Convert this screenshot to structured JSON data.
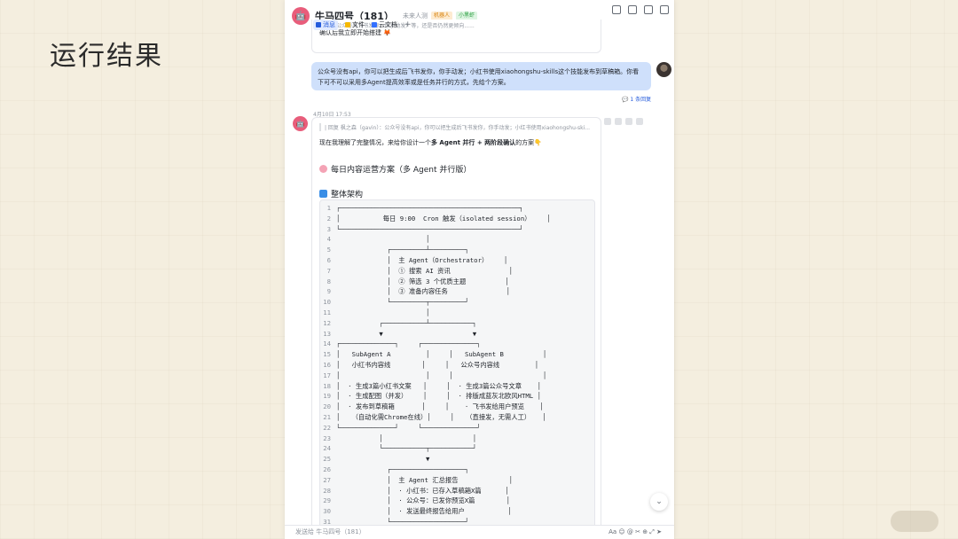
{
  "slide": {
    "title": "运行结果"
  },
  "chat": {
    "group_name": "牛马四号（181）",
    "group_meta": "未来人测",
    "tags": [
      "机器人",
      "小黑虾"
    ],
    "tabs": [
      {
        "label": "消息",
        "color": "#245bdb",
        "active": true
      },
      {
        "label": "文件",
        "color": "#f5b800",
        "active": false
      },
      {
        "label": "云文档",
        "color": "#3370ff",
        "active": false
      }
    ],
    "tab_add": "+",
    "prev_message": {
      "faded": "...... 从公众号先飞书发你，你手动发）等，还是否仍然更倾向......",
      "text": "确认后我立即开始搭建 🦊"
    },
    "user_message": "公众号没有api，你可以把生成后飞书发你，你手动发；小红书使用xiaohongshu-skills这个技能发布到草稿箱。你看下可不可以采用多Agent提高效率或是任务并行的方式，先给个方案。",
    "reply_count": "1 条回复",
    "timestamp": "4月10日 17:53",
    "bot_message": {
      "quote": "| 回复 枫之森（gavin）：公众号没有api，你可以把生成后飞书发你，你手动发；小红书使用xiaohongshu-ski...",
      "intro_before": "现在我理解了完整情况，来给你设计一个",
      "intro_bold": "多 Agent 并行 + 两阶段确认",
      "intro_after": "的方案👇",
      "plan_title": "每日内容运营方案（多 Agent 并行版）",
      "section_title": "整体架构",
      "code_lines": [
        {
          "n": "1",
          "t": "┌──────────────────────────────────────────────┐"
        },
        {
          "n": "2",
          "t": "│           每日 9:00  Cron 触发（isolated session）    │"
        },
        {
          "n": "3",
          "t": "└──────────────────────────────────────────────┘"
        },
        {
          "n": "4",
          "t": "                       │"
        },
        {
          "n": "5",
          "t": "             ┌─────────┴─────────┐"
        },
        {
          "n": "6",
          "t": "             │  主 Agent（Orchestrator）    │"
        },
        {
          "n": "7",
          "t": "             │  ① 搜索 AI 资讯               │"
        },
        {
          "n": "8",
          "t": "             │  ② 筛选 3 个优质主题          │"
        },
        {
          "n": "9",
          "t": "             │  ③ 准备内容任务               │"
        },
        {
          "n": "10",
          "t": "             └─────────┬─────────┘"
        },
        {
          "n": "11",
          "t": "                       │"
        },
        {
          "n": "12",
          "t": "           ┌───────────┴───────────┐"
        },
        {
          "n": "13",
          "t": "           ▼                       ▼"
        },
        {
          "n": "14",
          "t": "┌──────────────┐     ┌──────────────┐"
        },
        {
          "n": "15",
          "t": "│   SubAgent A         │     │   SubAgent B          │"
        },
        {
          "n": "16",
          "t": "│   小红书内容线        │     │   公众号内容线         │"
        },
        {
          "n": "17",
          "t": "│                      │     │                       │"
        },
        {
          "n": "18",
          "t": "│  · 生成3篇小红书文案   │     │  · 生成3篇公众号文章    │"
        },
        {
          "n": "19",
          "t": "│  · 生成配图（并发）    │     │  · 排版成蓝灰北欧风HTML │"
        },
        {
          "n": "20",
          "t": "│  · 发布到草稿箱       │     │    · 飞书发给用户预览    │"
        },
        {
          "n": "21",
          "t": "│   （自动化需Chrome在线）│     │   （直接发，无需人工）   │"
        },
        {
          "n": "22",
          "t": "└──────────────┘     └──────────────┘"
        },
        {
          "n": "23",
          "t": "           │                       │"
        },
        {
          "n": "24",
          "t": "           └───────────┬───────────┘"
        },
        {
          "n": "25",
          "t": "                       ▼"
        },
        {
          "n": "26",
          "t": "             ┌───────────────────┐"
        },
        {
          "n": "27",
          "t": "             │  主 Agent 汇总报告             │"
        },
        {
          "n": "28",
          "t": "             │  · 小红书：已存入草稿箱X篇      │"
        },
        {
          "n": "29",
          "t": "             │  · 公众号：已发你预览X篇        │"
        },
        {
          "n": "30",
          "t": "             │  · 发送最终报告给用户           │"
        },
        {
          "n": "31",
          "t": "             └───────────────────┘"
        }
      ]
    },
    "input_placeholder": "发送给 牛马四号（181）",
    "input_tools": "Aa ☺ @ ✂ ⊕ ⤢ ➤"
  },
  "colors": {
    "accent": "#245bdb",
    "user_bubble": "#cfe0fb",
    "bot_avatar": "#e85d7b",
    "slide_bg": "#f4eedf"
  }
}
